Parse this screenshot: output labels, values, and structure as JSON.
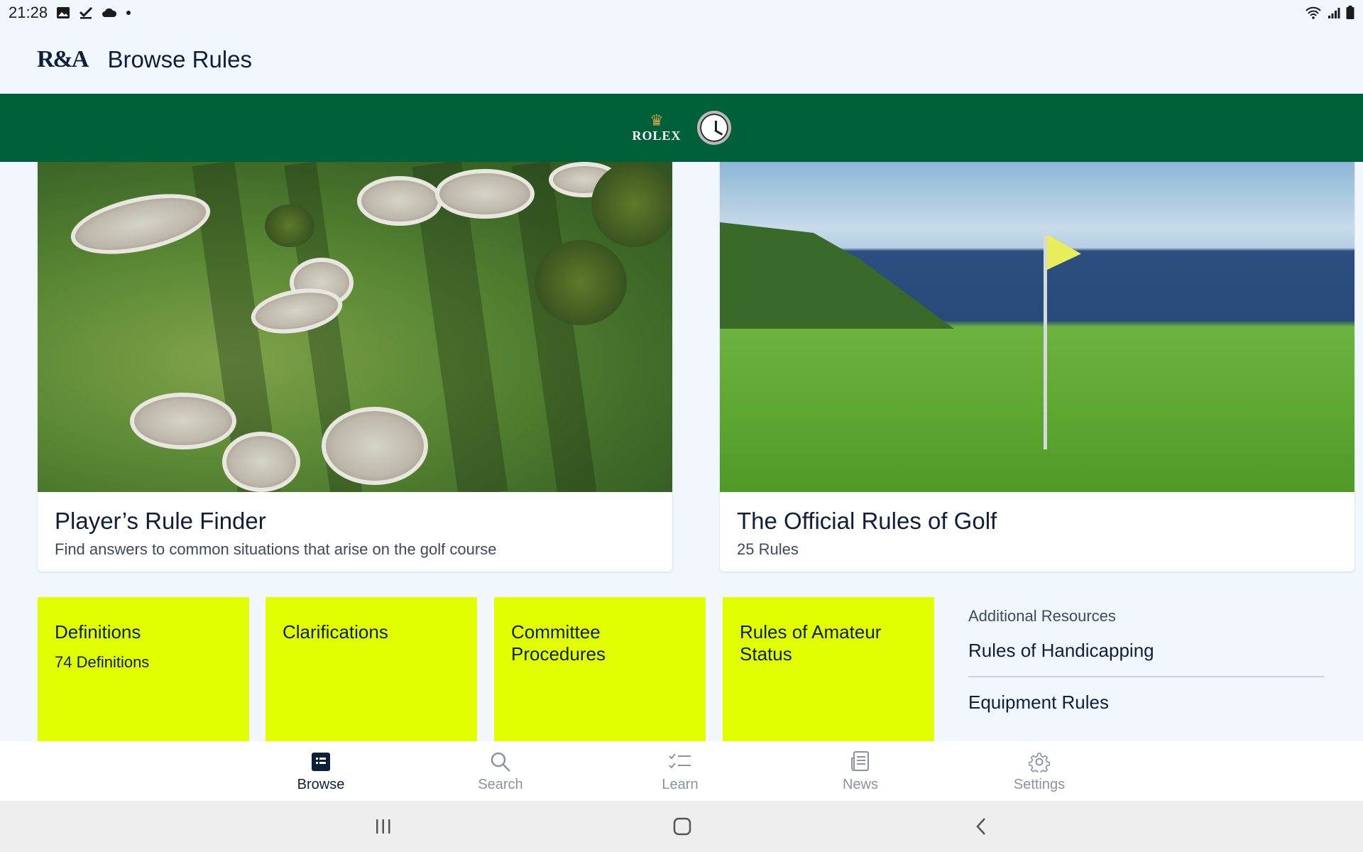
{
  "status_bar": {
    "time": "21:28",
    "left_icons": [
      "image-icon",
      "check-icon",
      "cloud-icon",
      "dot-icon"
    ],
    "right_icons": [
      "wifi-icon",
      "signal-icon",
      "battery-icon"
    ]
  },
  "header": {
    "logo": "R&A",
    "title": "Browse Rules"
  },
  "sponsor": {
    "name": "ROLEX",
    "icons": [
      "crown-icon",
      "clock-icon"
    ],
    "background": "#006039"
  },
  "cards": [
    {
      "title": "Player’s Rule Finder",
      "subtitle": "Find answers to common situations that arise on the golf course"
    },
    {
      "title": "The Official Rules of Golf",
      "subtitle": "25 Rules"
    }
  ],
  "tiles": [
    {
      "title": "Definitions",
      "subtitle": "74 Definitions"
    },
    {
      "title": "Clarifications",
      "subtitle": ""
    },
    {
      "title": "Committee Procedures",
      "subtitle": ""
    },
    {
      "title": "Rules of Amateur Status",
      "subtitle": ""
    }
  ],
  "tile_color": "#e1ff00",
  "resources": {
    "heading": "Additional Resources",
    "items": [
      "Rules of Handicapping",
      "Equipment Rules"
    ]
  },
  "bottom_nav": {
    "items": [
      {
        "label": "Browse",
        "icon": "browse-icon",
        "active": true
      },
      {
        "label": "Search",
        "icon": "search-icon",
        "active": false
      },
      {
        "label": "Learn",
        "icon": "checklist-icon",
        "active": false
      },
      {
        "label": "News",
        "icon": "news-icon",
        "active": false
      },
      {
        "label": "Settings",
        "icon": "gear-icon",
        "active": false
      }
    ]
  },
  "system_nav": [
    "recents-icon",
    "home-icon",
    "back-icon"
  ]
}
